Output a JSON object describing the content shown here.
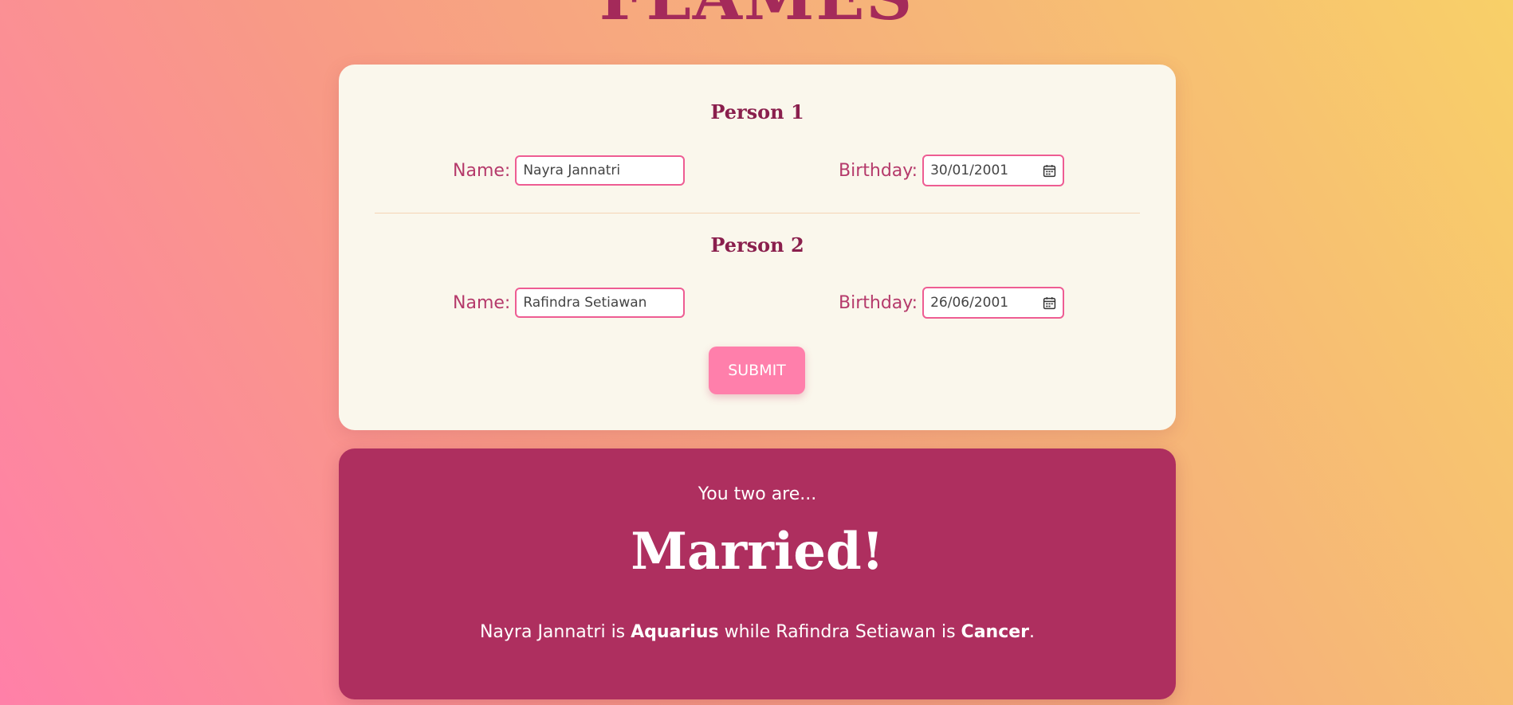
{
  "app": {
    "title": "FLAMES"
  },
  "person1": {
    "heading": "Person 1",
    "name_label": "Name:",
    "name_value": "Nayra Jannatri",
    "birthday_label": "Birthday:",
    "birthday_value": "30/01/2001"
  },
  "person2": {
    "heading": "Person 2",
    "name_label": "Name:",
    "name_value": "Rafindra Setiawan",
    "birthday_label": "Birthday:",
    "birthday_value": "26/06/2001"
  },
  "form": {
    "submit_label": "SUBMIT"
  },
  "result": {
    "intro": "You two are...",
    "value": "Married!",
    "zodiac": {
      "person1_name": "Nayra Jannatri",
      "is_1": " is ",
      "person1_sign": "Aquarius",
      "while": " while ",
      "person2_name": "Rafindra Setiawan",
      "is_2": " is ",
      "person2_sign": "Cancer",
      "end": "."
    }
  },
  "colors": {
    "title": "#a42a5a",
    "card_bg": "#faf7ec",
    "heading": "#8a1f4d",
    "label": "#b53a6b",
    "input_border": "#ee5d93",
    "button_bg": "#ff7fab",
    "result_bg": "#ae2f5f"
  },
  "icons": {
    "date_picker": "calendar-icon"
  }
}
